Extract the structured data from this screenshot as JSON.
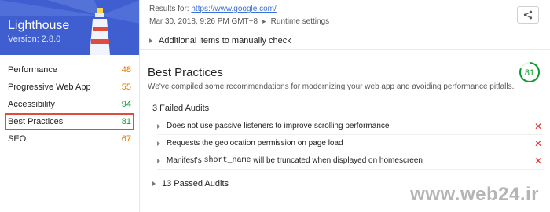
{
  "brand": {
    "title": "Lighthouse",
    "version": "Version: 2.8.0"
  },
  "sidebar": {
    "items": [
      {
        "label": "Performance",
        "score": "48",
        "color": "#e67700"
      },
      {
        "label": "Progressive Web App",
        "score": "55",
        "color": "#e67700"
      },
      {
        "label": "Accessibility",
        "score": "94",
        "color": "#0c9b2e"
      },
      {
        "label": "Best Practices",
        "score": "81",
        "color": "#0c9b2e",
        "selected": true
      },
      {
        "label": "SEO",
        "score": "67",
        "color": "#e67700"
      }
    ]
  },
  "header": {
    "results_for": "Results for:",
    "url": "https://www.google.com/",
    "timestamp": "Mar 30, 2018, 9:26 PM GMT+8",
    "runtime_settings": "Runtime settings",
    "share_icon": "share-icon"
  },
  "main": {
    "additional_items": "Additional items to manually check",
    "section_title": "Best Practices",
    "section_desc": "We've compiled some recommendations for modernizing your web app and avoiding performance pitfalls.",
    "score": "81",
    "failed_title": "3 Failed Audits",
    "failed": [
      {
        "text": "Does not use passive listeners to improve scrolling performance"
      },
      {
        "text": "Requests the geolocation permission on page load"
      },
      {
        "pre": "Manifest's",
        "code": "short_name",
        "post": "will be truncated when displayed on homescreen"
      }
    ],
    "passed_title": "13 Passed Audits"
  },
  "watermark": "www.web24.ir",
  "colors": {
    "brand": "#3f5ecf",
    "pass": "#0c9b2e",
    "average": "#e67700",
    "fail": "#e0332b",
    "selection": "#e04c3c"
  }
}
